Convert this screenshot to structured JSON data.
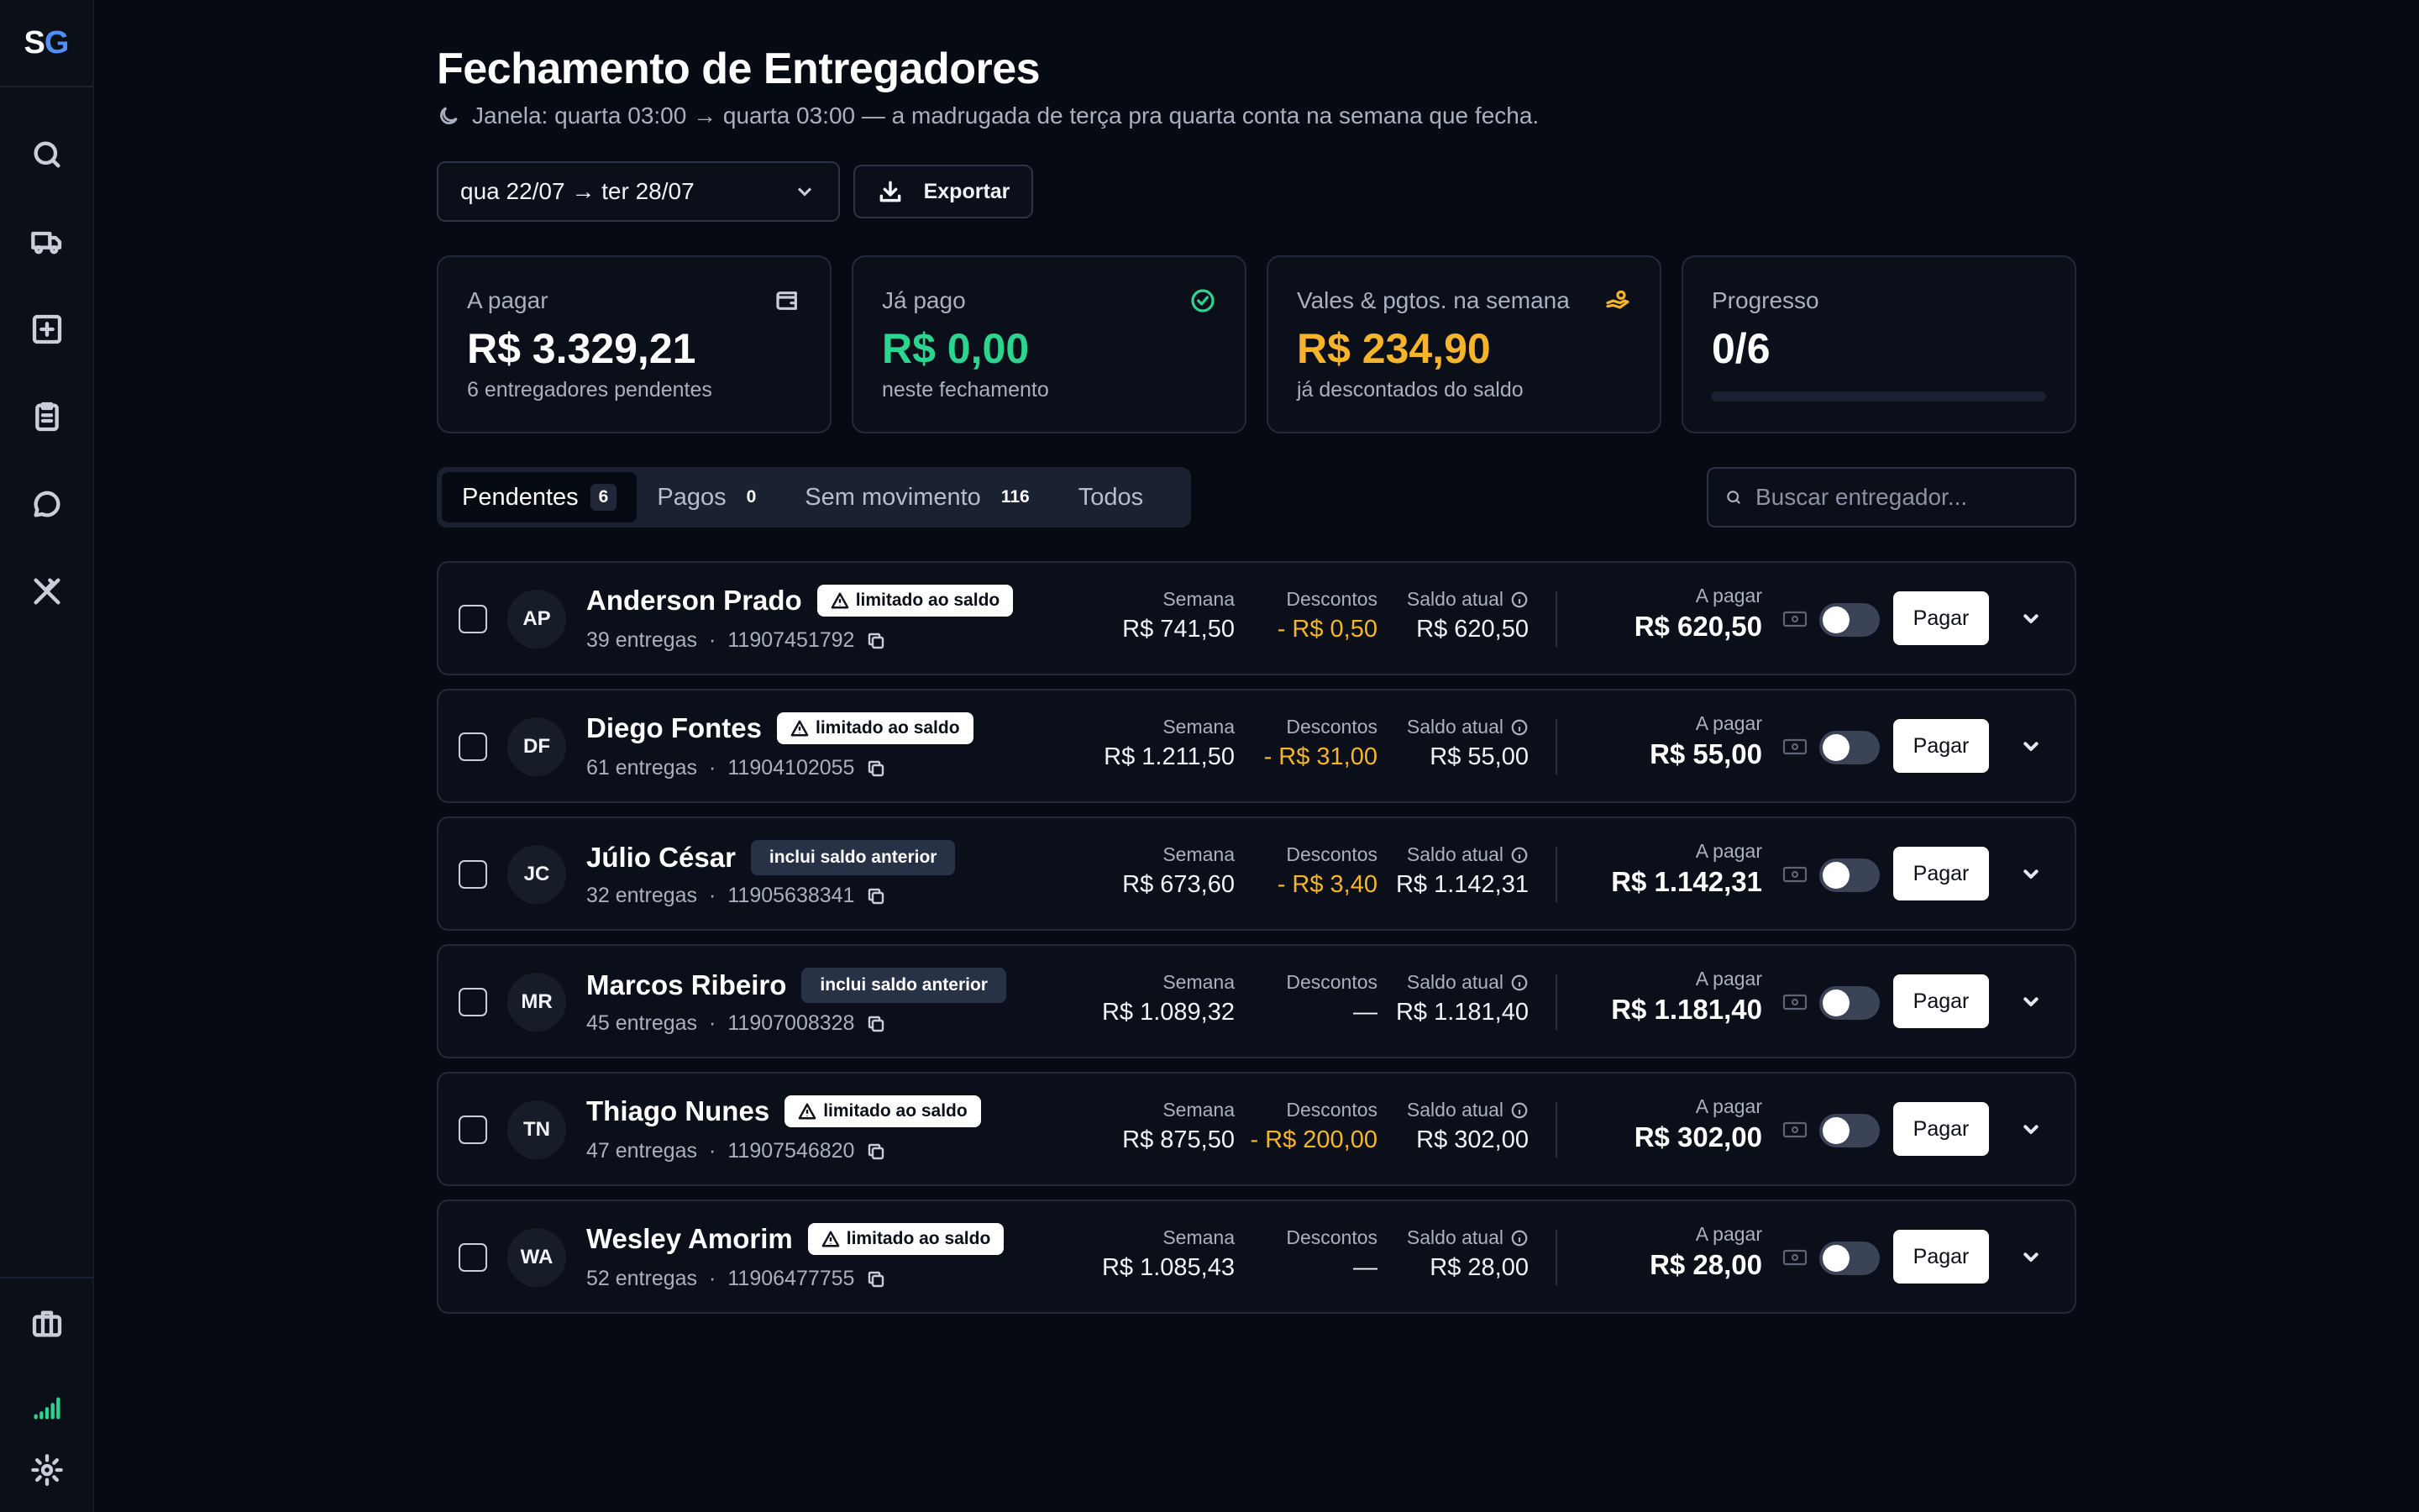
{
  "app": {
    "logo_s": "S",
    "logo_g": "G"
  },
  "sidebar": {
    "items": [
      {
        "icon": "search-icon"
      },
      {
        "icon": "truck-icon"
      },
      {
        "icon": "plus-square-icon"
      },
      {
        "icon": "clipboard-icon"
      },
      {
        "icon": "chat-icon"
      },
      {
        "icon": "utensils-icon"
      }
    ],
    "bottom": [
      {
        "icon": "briefcase-icon"
      },
      {
        "icon": "signal-icon"
      },
      {
        "icon": "gear-icon"
      }
    ]
  },
  "header": {
    "title": "Fechamento de Entregadores",
    "subtitle": "Janela: quarta 03:00 → quarta 03:00 — a madrugada de terça pra quarta conta na semana que fecha."
  },
  "toolbar": {
    "date_range": "qua 22/07 → ter 28/07",
    "export_label": "Exportar"
  },
  "stats": {
    "a_pagar": {
      "label": "A pagar",
      "value": "R$ 3.329,21",
      "sub": "6 entregadores pendentes"
    },
    "ja_pago": {
      "label": "Já pago",
      "value": "R$ 0,00",
      "sub": "neste fechamento",
      "color": "#2bd48f"
    },
    "vales": {
      "label": "Vales & pgtos. na semana",
      "value": "R$ 234,90",
      "sub": "já descontados do saldo",
      "color": "#f5b429"
    },
    "progresso": {
      "label": "Progresso",
      "value": "0/6",
      "fraction": 0
    }
  },
  "tabs": [
    {
      "label": "Pendentes",
      "count": "6"
    },
    {
      "label": "Pagos",
      "count": "0"
    },
    {
      "label": "Sem movimento",
      "count": "116"
    },
    {
      "label": "Todos",
      "count": ""
    }
  ],
  "search": {
    "placeholder": "Buscar entregador..."
  },
  "columns": {
    "semana": "Semana",
    "descontos": "Descontos",
    "saldo": "Saldo atual",
    "a_pagar": "A pagar",
    "pay_button": "Pagar"
  },
  "rows": [
    {
      "initials": "AP",
      "name": "Anderson Prado",
      "badge": "limitado ao saldo",
      "badge_type": "warn",
      "entregas": "39 entregas",
      "sep": "·",
      "phone": "11907451792",
      "semana": "R$ 741,50",
      "descontos": "- R$ 0,50",
      "saldo": "R$ 620,50",
      "a_pagar": "R$ 620,50"
    },
    {
      "initials": "DF",
      "name": "Diego Fontes",
      "badge": "limitado ao saldo",
      "badge_type": "warn",
      "entregas": "61 entregas",
      "sep": "·",
      "phone": "11904102055",
      "semana": "R$ 1.211,50",
      "descontos": "- R$ 31,00",
      "saldo": "R$ 55,00",
      "a_pagar": "R$ 55,00"
    },
    {
      "initials": "JC",
      "name": "Júlio César",
      "badge": "inclui saldo anterior",
      "badge_type": "info",
      "entregas": "32 entregas",
      "sep": "·",
      "phone": "11905638341",
      "semana": "R$ 673,60",
      "descontos": "- R$ 3,40",
      "saldo": "R$ 1.142,31",
      "a_pagar": "R$ 1.142,31"
    },
    {
      "initials": "MR",
      "name": "Marcos Ribeiro",
      "badge": "inclui saldo anterior",
      "badge_type": "info",
      "entregas": "45 entregas",
      "sep": "·",
      "phone": "11907008328",
      "semana": "R$ 1.089,32",
      "descontos": "—",
      "saldo": "R$ 1.181,40",
      "a_pagar": "R$ 1.181,40"
    },
    {
      "initials": "TN",
      "name": "Thiago Nunes",
      "badge": "limitado ao saldo",
      "badge_type": "warn",
      "entregas": "47 entregas",
      "sep": "·",
      "phone": "11907546820",
      "semana": "R$ 875,50",
      "descontos": "- R$ 200,00",
      "saldo": "R$ 302,00",
      "a_pagar": "R$ 302,00"
    },
    {
      "initials": "WA",
      "name": "Wesley Amorim",
      "badge": "limitado ao saldo",
      "badge_type": "warn",
      "entregas": "52 entregas",
      "sep": "·",
      "phone": "11906477755",
      "semana": "R$ 1.085,43",
      "descontos": "—",
      "saldo": "R$ 28,00",
      "a_pagar": "R$ 28,00"
    }
  ]
}
